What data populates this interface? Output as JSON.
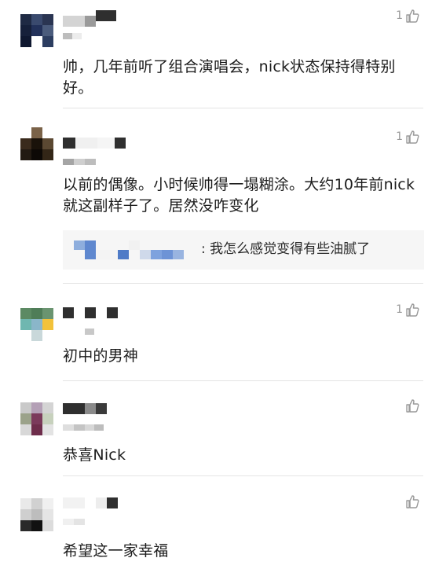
{
  "comments": [
    {
      "text": "帅，几年前听了组合演唱会，nick状态保持得特别好。",
      "likes": "1"
    },
    {
      "text": "以前的偶像。小时候帅得一塌糊涂。大约10年前nick就这副样子了。居然没咋变化",
      "likes": "1",
      "reply": {
        "text": ": 我怎么感觉变得有些油腻了"
      }
    },
    {
      "text": "初中的男神",
      "likes": "1"
    },
    {
      "text": "恭喜Nick",
      "likes": ""
    },
    {
      "text": "希望这一家幸福",
      "likes": ""
    }
  ],
  "icons": {
    "like": "thumbs-up-icon"
  },
  "colors": {
    "meta": "#9a9a9a",
    "text": "#1c1c1c",
    "divider": "#e4e4e4",
    "reply_bg": "#f6f6f6"
  }
}
